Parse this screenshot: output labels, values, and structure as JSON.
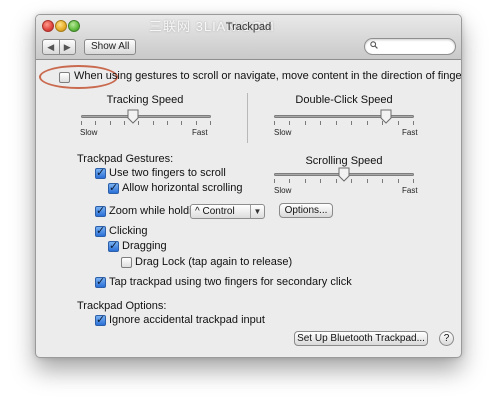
{
  "window": {
    "title": "Trackpad",
    "watermark": "三联网 3LIAN.COM",
    "nav": {
      "back_icon": "chevron-left-icon",
      "forward_icon": "chevron-right-icon"
    },
    "show_all_label": "Show All",
    "search": {
      "value": "",
      "placeholder": ""
    }
  },
  "top_option": {
    "label": "When using gestures to scroll or navigate, move content in the direction of finger movement",
    "checked": false
  },
  "tracking_speed": {
    "title": "Tracking Speed",
    "min_label": "Slow",
    "max_label": "Fast",
    "value": 0.4
  },
  "double_click_speed": {
    "title": "Double-Click Speed",
    "min_label": "Slow",
    "max_label": "Fast",
    "value": 0.8
  },
  "trackpad_gestures": {
    "heading": "Trackpad Gestures:",
    "use_two_fingers": {
      "label": "Use two fingers to scroll",
      "checked": true
    },
    "allow_horizontal": {
      "label": "Allow horizontal scrolling",
      "checked": true
    },
    "zoom_while_holding": {
      "label": "Zoom while holding",
      "checked": true,
      "modifier_value": "^ Control",
      "options_label": "Options..."
    },
    "clicking": {
      "label": "Clicking",
      "checked": true
    },
    "dragging": {
      "label": "Dragging",
      "checked": true
    },
    "drag_lock": {
      "label": "Drag Lock (tap again to release)",
      "checked": false
    },
    "tap_secondary": {
      "label": "Tap trackpad using two fingers for secondary click",
      "checked": true
    }
  },
  "scrolling_speed": {
    "title": "Scrolling Speed",
    "min_label": "Slow",
    "max_label": "Fast",
    "value": 0.5
  },
  "trackpad_options": {
    "heading": "Trackpad Options:",
    "ignore_accidental": {
      "label": "Ignore accidental trackpad input",
      "checked": true
    }
  },
  "buttons": {
    "setup_bluetooth": "Set Up Bluetooth Trackpad...",
    "help": "?"
  },
  "colors": {
    "annotation": "#c96a4f",
    "checkbox_checked": "#2a6fd6"
  }
}
